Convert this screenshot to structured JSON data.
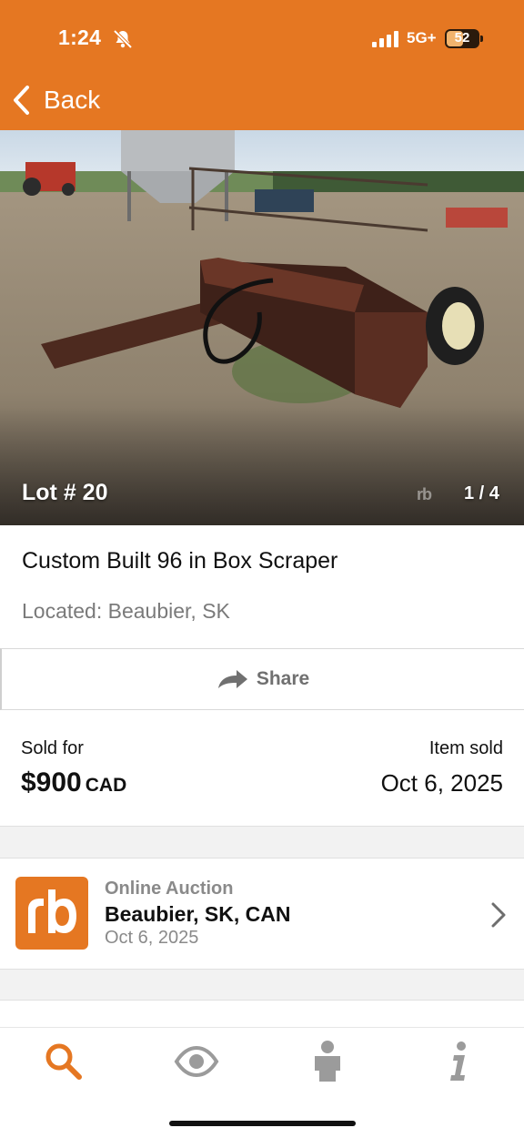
{
  "status_bar": {
    "time": "1:24",
    "network": "5G+",
    "battery": "52"
  },
  "header": {
    "back_label": "Back",
    "accent_color": "#e57722"
  },
  "photo": {
    "lot": "Lot # 20",
    "counter": "1 / 4",
    "watermark": "rb"
  },
  "item": {
    "title": "Custom Built 96 in Box Scraper",
    "location": "Located: Beaubier, SK",
    "share_label": "Share"
  },
  "sale": {
    "sold_label": "Sold for",
    "price": "$900",
    "currency": "CAD",
    "item_sold_label": "Item sold",
    "date": "Oct 6, 2025"
  },
  "auction": {
    "logo_text": "rb",
    "type": "Online Auction",
    "location": "Beaubier, SK, CAN",
    "date": "Oct 6, 2025"
  },
  "tabs": [
    {
      "icon": "search-icon",
      "active": true
    },
    {
      "icon": "eye-icon",
      "active": false
    },
    {
      "icon": "person-icon",
      "active": false
    },
    {
      "icon": "info-icon",
      "active": false
    }
  ]
}
